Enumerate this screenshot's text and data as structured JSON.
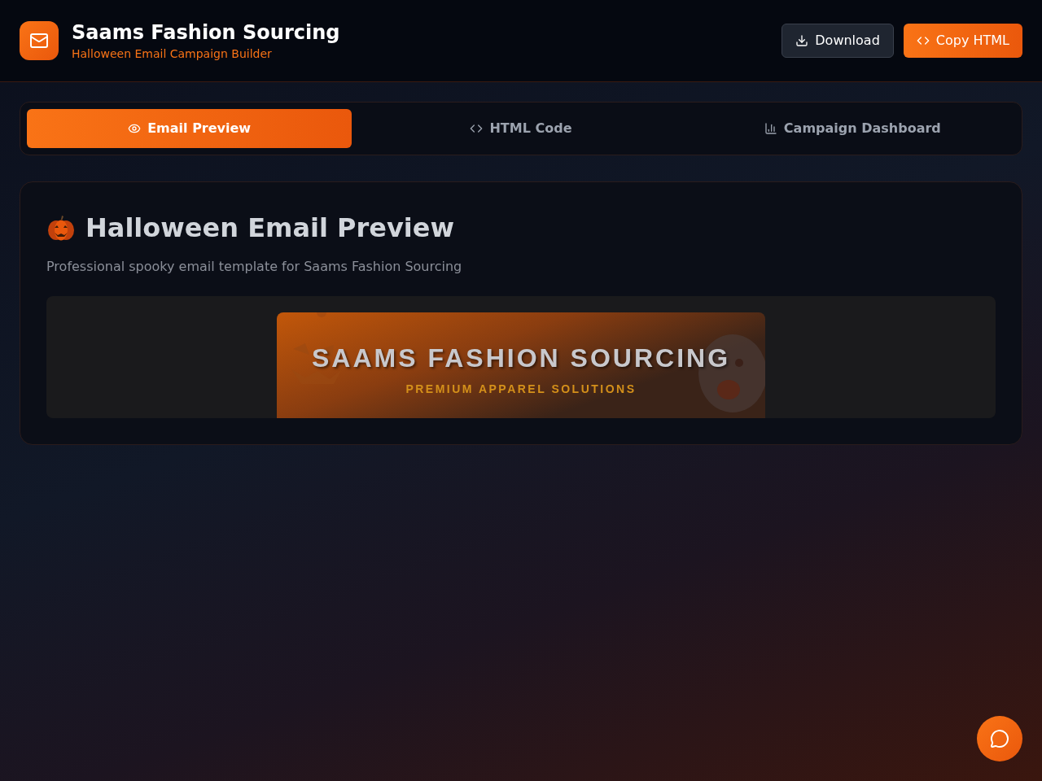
{
  "header": {
    "title": "Saams Fashion Sourcing",
    "subtitle": "Halloween Email Campaign Builder",
    "buttons": [
      {
        "kind": "download",
        "label": "Download",
        "primary": false
      },
      {
        "kind": "code",
        "label": "Copy HTML",
        "primary": true
      }
    ]
  },
  "tabs": [
    {
      "kind": "eye",
      "label": "Email Preview",
      "selected": true
    },
    {
      "kind": "code",
      "label": "HTML Code",
      "selected": false
    },
    {
      "kind": "chart",
      "label": "Campaign Dashboard",
      "selected": false
    }
  ],
  "preview": {
    "title": "Halloween Email Preview",
    "description": "Professional spooky email template for Saams Fashion Sourcing",
    "banner": {
      "title": "SAAMS FASHION SOURCING",
      "tagline": "PREMIUM APPAREL SOLUTIONS"
    }
  }
}
